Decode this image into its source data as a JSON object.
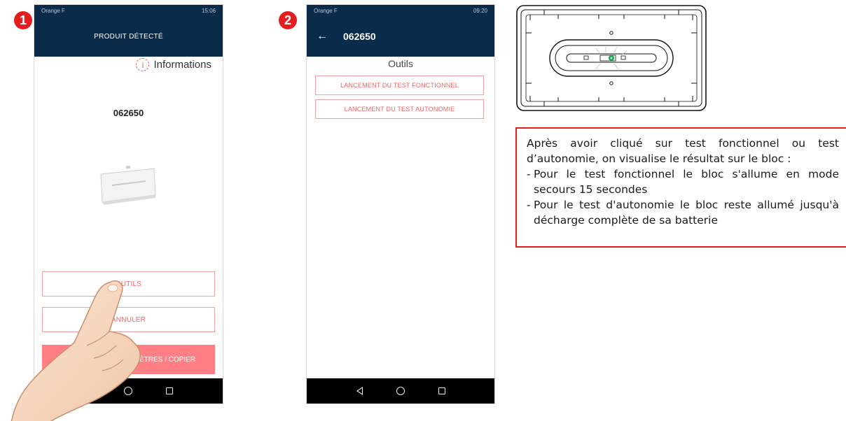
{
  "steps": [
    "1",
    "2"
  ],
  "phone1": {
    "status_left": "Orange F",
    "status_right": "15:06",
    "title": "PRODUIT DÉTECTÉ",
    "info_label": "Informations",
    "product_code": "062650",
    "buttons": {
      "outils": "OUTILS",
      "annuler": "ANNULER",
      "params": "ES PARAMÈTRES / COPIER"
    }
  },
  "phone2": {
    "status_left": "Orange F",
    "status_right": "09:20",
    "title": "062650",
    "section_title": "Outils",
    "buttons": {
      "test_fonctionnel": "LANCEMENT DU TEST FONCTIONNEL",
      "test_autonomie": "LANCEMENT DU TEST AUTONOMIE"
    }
  },
  "note": {
    "intro": "Après avoir cliqué sur test fonctionnel ou test d’autonomie, on visualise le résultat sur le bloc :",
    "items": [
      "Pour le test fonctionnel le bloc s'allume en mode secours 15 secondes",
      "Pour le test d'autonomie le bloc reste allumé jusqu'à  décharge complète de sa batterie"
    ]
  },
  "colors": {
    "accent_red": "#e41e1e",
    "appbar_navy": "#0a2b4a",
    "button_pink": "#ff7f84",
    "button_outline_text": "#ef6363"
  }
}
